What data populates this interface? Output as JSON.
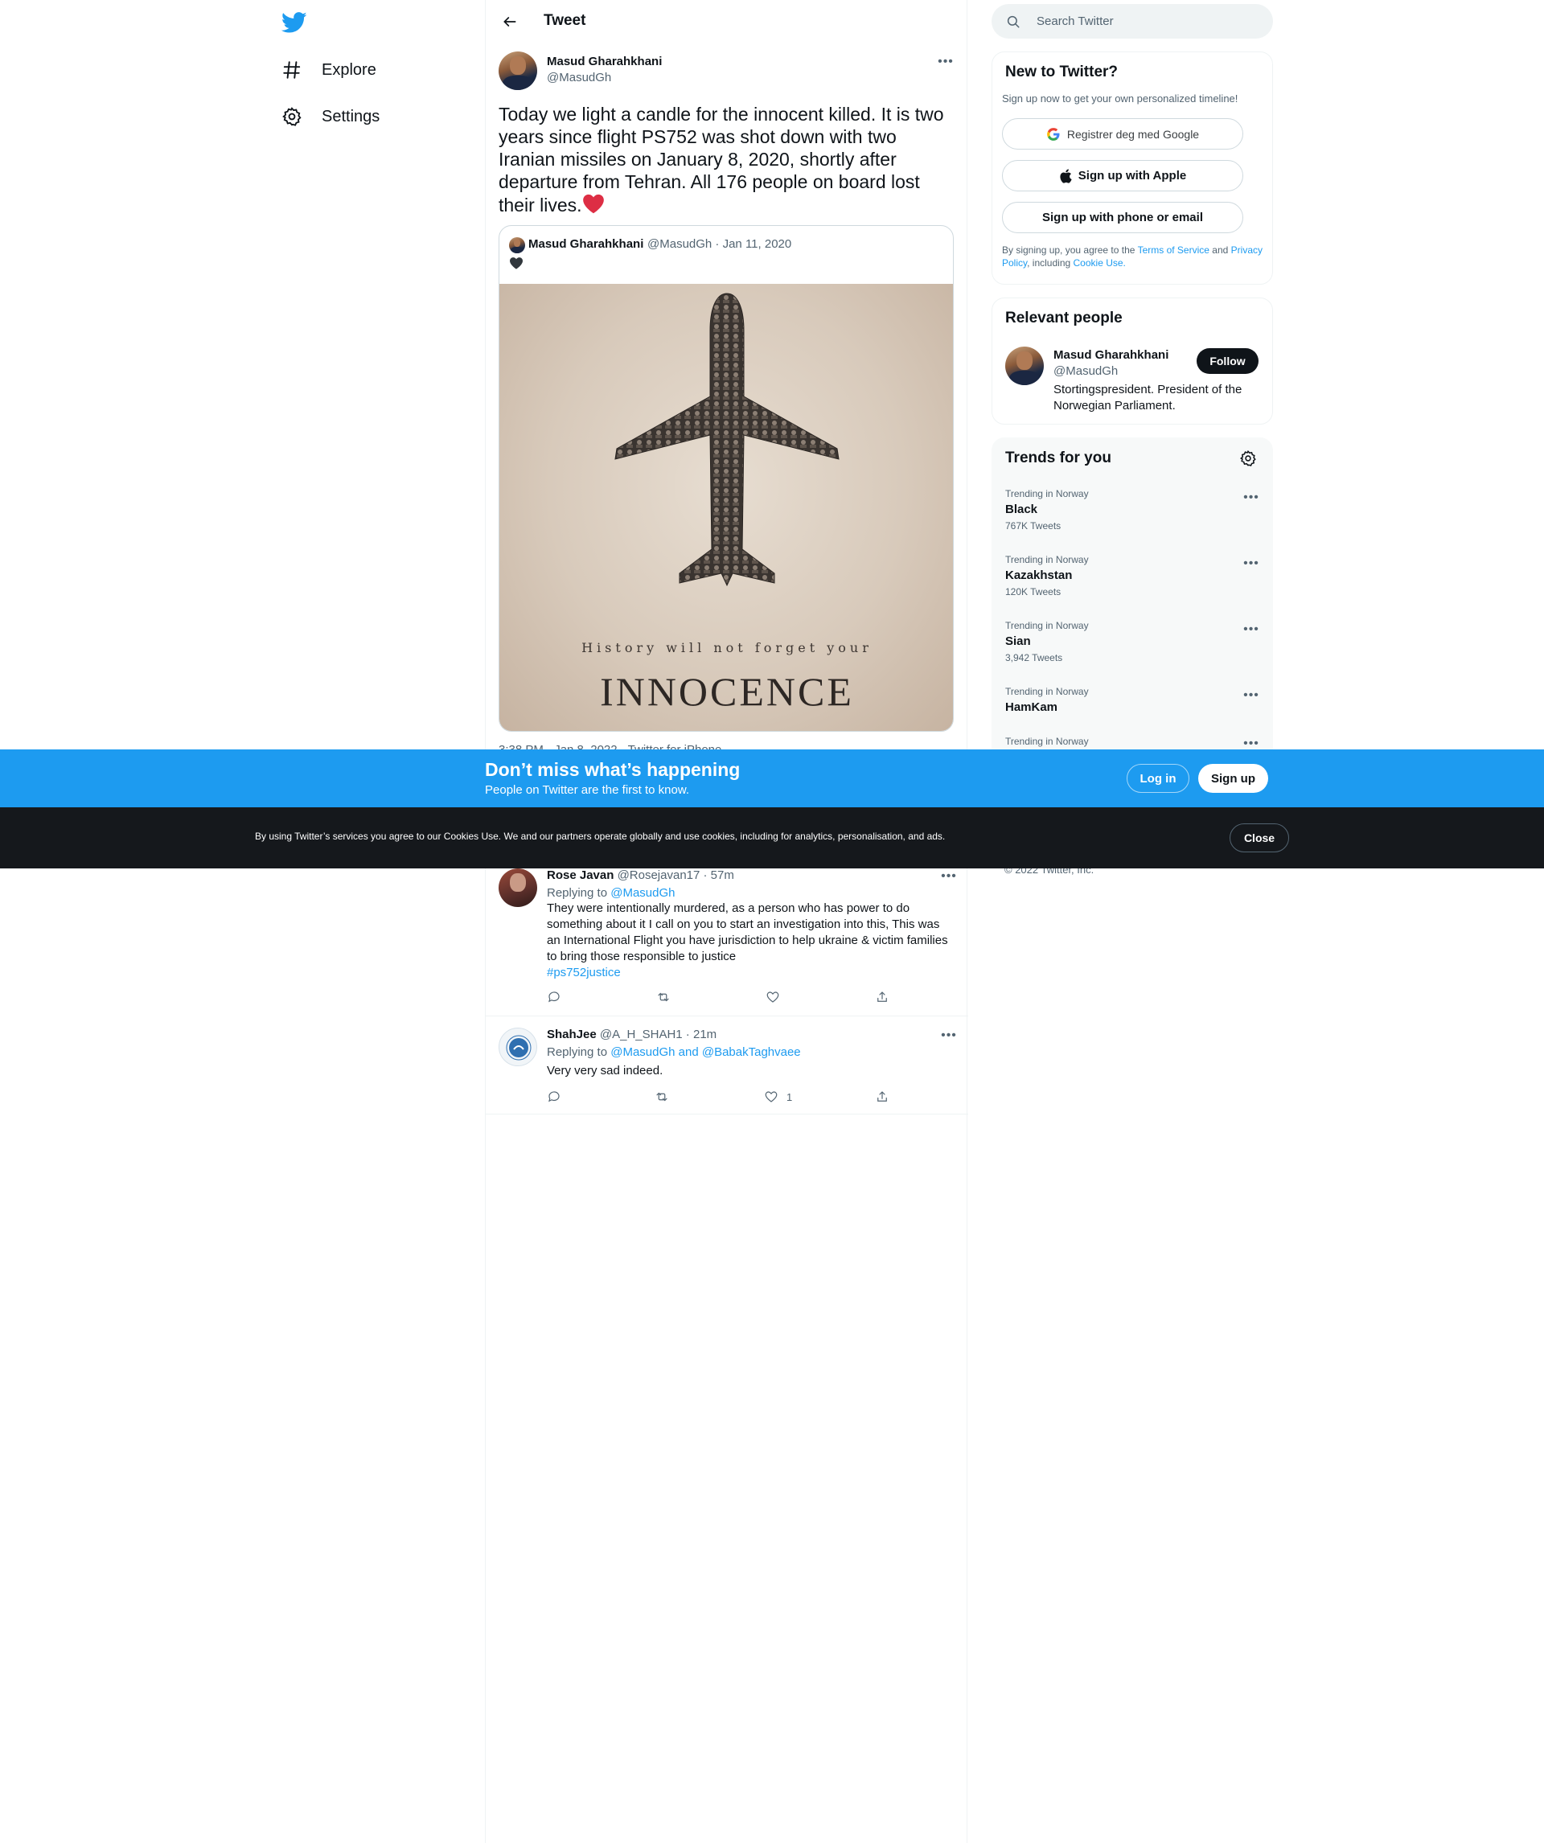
{
  "nav": {
    "items": [
      {
        "label": "Explore",
        "icon": "hashtag-icon"
      },
      {
        "label": "Settings",
        "icon": "gear-icon"
      }
    ]
  },
  "header": {
    "title": "Tweet"
  },
  "tweet": {
    "author_name": "Masud Gharahkhani",
    "author_handle": "@MasudGh",
    "text": "Today we light a candle for the innocent killed. It is two years since flight PS752 was shot down with two Iranian missiles on January 8, 2020, shortly after departure from Tehran. All 176 people on board lost their lives.",
    "emoji": "❤️",
    "meta_partial": "3:38 PM · Jan 8, 2022 · Twitter for iPhone"
  },
  "quote": {
    "author_name": "Masud Gharahkhani",
    "handle_date": "@MasudGh · Jan 11, 2020",
    "emoji": "🖤",
    "poster_line1": "History will not forget your",
    "poster_line2": "INNOCENCE"
  },
  "replies": [
    {
      "name": "Rose Javan",
      "handle_time": "@Rosejavan17 · 57m",
      "replying_to_label": "Replying to",
      "replying_to": "@MasudGh",
      "text": "They were intentionally murdered,  as a person who has power to do something about it I call on you to start an investigation into this, This was an International Flight you have jurisdiction to help ukraine & victim families to bring those responsible to justice",
      "hashtag": "#ps752justice",
      "likes": ""
    },
    {
      "name": "ShahJee",
      "handle_time": "@A_H_SHAH1 · 21m",
      "replying_to_label": "Replying to",
      "replying_to": "@MasudGh and @BabakTaghvaee",
      "text": "Very very sad indeed.",
      "hashtag": "",
      "likes": "1"
    }
  ],
  "search": {
    "placeholder": "Search Twitter"
  },
  "signup_card": {
    "title": "New to Twitter?",
    "subtitle": "Sign up now to get your own personalized timeline!",
    "google_label": "Registrer deg med Google",
    "apple_label": "Sign up with Apple",
    "phone_label": "Sign up with phone or email",
    "legal_prefix": "By signing up, you agree to the",
    "terms": "Terms of Service",
    "and": "and",
    "privacy": "Privacy Policy",
    "including": ", including",
    "cookie": "Cookie Use."
  },
  "relevant": {
    "title": "Relevant people",
    "name": "Masud Gharahkhani",
    "handle": "@MasudGh",
    "bio": "Stortingspresident. President of the Norwegian Parliament.",
    "follow_label": "Follow"
  },
  "trends": {
    "title": "Trends for you",
    "items": [
      {
        "context": "Trending in Norway",
        "name": "Black",
        "count": "767K Tweets"
      },
      {
        "context": "Trending in Norway",
        "name": "Kazakhstan",
        "count": "120K Tweets"
      },
      {
        "context": "Trending in Norway",
        "name": "Sian",
        "count": "3,942 Tweets"
      },
      {
        "context": "Trending in Norway",
        "name": "HamKam",
        "count": ""
      },
      {
        "context": "Trending in Norway",
        "name": "",
        "count": ""
      }
    ]
  },
  "footer": {
    "copyright": "© 2022 Twitter, Inc."
  },
  "blue_banner": {
    "title": "Don’t miss what’s happening",
    "subtitle": "People on Twitter are the first to know.",
    "login_label": "Log in",
    "signup_label": "Sign up"
  },
  "cookie_banner": {
    "text": "By using Twitter’s services you agree to our Cookies Use. We and our partners operate globally and use cookies, including for analytics, personalisation, and ads.",
    "close_label": "Close"
  },
  "colors": {
    "accent": "#1d9bf0",
    "text": "#0f1419",
    "muted": "#536471",
    "dark_banner": "#15181c"
  }
}
